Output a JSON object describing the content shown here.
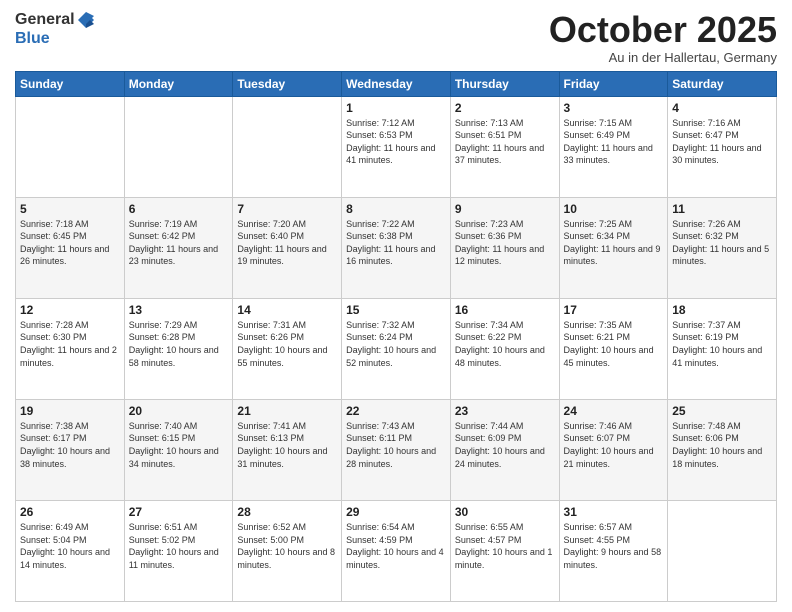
{
  "header": {
    "logo_general": "General",
    "logo_blue": "Blue",
    "month_title": "October 2025",
    "subtitle": "Au in der Hallertau, Germany"
  },
  "weekdays": [
    "Sunday",
    "Monday",
    "Tuesday",
    "Wednesday",
    "Thursday",
    "Friday",
    "Saturday"
  ],
  "days": {
    "d1": {
      "num": "1",
      "sunrise": "Sunrise: 7:12 AM",
      "sunset": "Sunset: 6:53 PM",
      "daylight": "Daylight: 11 hours and 41 minutes."
    },
    "d2": {
      "num": "2",
      "sunrise": "Sunrise: 7:13 AM",
      "sunset": "Sunset: 6:51 PM",
      "daylight": "Daylight: 11 hours and 37 minutes."
    },
    "d3": {
      "num": "3",
      "sunrise": "Sunrise: 7:15 AM",
      "sunset": "Sunset: 6:49 PM",
      "daylight": "Daylight: 11 hours and 33 minutes."
    },
    "d4": {
      "num": "4",
      "sunrise": "Sunrise: 7:16 AM",
      "sunset": "Sunset: 6:47 PM",
      "daylight": "Daylight: 11 hours and 30 minutes."
    },
    "d5": {
      "num": "5",
      "sunrise": "Sunrise: 7:18 AM",
      "sunset": "Sunset: 6:45 PM",
      "daylight": "Daylight: 11 hours and 26 minutes."
    },
    "d6": {
      "num": "6",
      "sunrise": "Sunrise: 7:19 AM",
      "sunset": "Sunset: 6:42 PM",
      "daylight": "Daylight: 11 hours and 23 minutes."
    },
    "d7": {
      "num": "7",
      "sunrise": "Sunrise: 7:20 AM",
      "sunset": "Sunset: 6:40 PM",
      "daylight": "Daylight: 11 hours and 19 minutes."
    },
    "d8": {
      "num": "8",
      "sunrise": "Sunrise: 7:22 AM",
      "sunset": "Sunset: 6:38 PM",
      "daylight": "Daylight: 11 hours and 16 minutes."
    },
    "d9": {
      "num": "9",
      "sunrise": "Sunrise: 7:23 AM",
      "sunset": "Sunset: 6:36 PM",
      "daylight": "Daylight: 11 hours and 12 minutes."
    },
    "d10": {
      "num": "10",
      "sunrise": "Sunrise: 7:25 AM",
      "sunset": "Sunset: 6:34 PM",
      "daylight": "Daylight: 11 hours and 9 minutes."
    },
    "d11": {
      "num": "11",
      "sunrise": "Sunrise: 7:26 AM",
      "sunset": "Sunset: 6:32 PM",
      "daylight": "Daylight: 11 hours and 5 minutes."
    },
    "d12": {
      "num": "12",
      "sunrise": "Sunrise: 7:28 AM",
      "sunset": "Sunset: 6:30 PM",
      "daylight": "Daylight: 11 hours and 2 minutes."
    },
    "d13": {
      "num": "13",
      "sunrise": "Sunrise: 7:29 AM",
      "sunset": "Sunset: 6:28 PM",
      "daylight": "Daylight: 10 hours and 58 minutes."
    },
    "d14": {
      "num": "14",
      "sunrise": "Sunrise: 7:31 AM",
      "sunset": "Sunset: 6:26 PM",
      "daylight": "Daylight: 10 hours and 55 minutes."
    },
    "d15": {
      "num": "15",
      "sunrise": "Sunrise: 7:32 AM",
      "sunset": "Sunset: 6:24 PM",
      "daylight": "Daylight: 10 hours and 52 minutes."
    },
    "d16": {
      "num": "16",
      "sunrise": "Sunrise: 7:34 AM",
      "sunset": "Sunset: 6:22 PM",
      "daylight": "Daylight: 10 hours and 48 minutes."
    },
    "d17": {
      "num": "17",
      "sunrise": "Sunrise: 7:35 AM",
      "sunset": "Sunset: 6:21 PM",
      "daylight": "Daylight: 10 hours and 45 minutes."
    },
    "d18": {
      "num": "18",
      "sunrise": "Sunrise: 7:37 AM",
      "sunset": "Sunset: 6:19 PM",
      "daylight": "Daylight: 10 hours and 41 minutes."
    },
    "d19": {
      "num": "19",
      "sunrise": "Sunrise: 7:38 AM",
      "sunset": "Sunset: 6:17 PM",
      "daylight": "Daylight: 10 hours and 38 minutes."
    },
    "d20": {
      "num": "20",
      "sunrise": "Sunrise: 7:40 AM",
      "sunset": "Sunset: 6:15 PM",
      "daylight": "Daylight: 10 hours and 34 minutes."
    },
    "d21": {
      "num": "21",
      "sunrise": "Sunrise: 7:41 AM",
      "sunset": "Sunset: 6:13 PM",
      "daylight": "Daylight: 10 hours and 31 minutes."
    },
    "d22": {
      "num": "22",
      "sunrise": "Sunrise: 7:43 AM",
      "sunset": "Sunset: 6:11 PM",
      "daylight": "Daylight: 10 hours and 28 minutes."
    },
    "d23": {
      "num": "23",
      "sunrise": "Sunrise: 7:44 AM",
      "sunset": "Sunset: 6:09 PM",
      "daylight": "Daylight: 10 hours and 24 minutes."
    },
    "d24": {
      "num": "24",
      "sunrise": "Sunrise: 7:46 AM",
      "sunset": "Sunset: 6:07 PM",
      "daylight": "Daylight: 10 hours and 21 minutes."
    },
    "d25": {
      "num": "25",
      "sunrise": "Sunrise: 7:48 AM",
      "sunset": "Sunset: 6:06 PM",
      "daylight": "Daylight: 10 hours and 18 minutes."
    },
    "d26": {
      "num": "26",
      "sunrise": "Sunrise: 6:49 AM",
      "sunset": "Sunset: 5:04 PM",
      "daylight": "Daylight: 10 hours and 14 minutes."
    },
    "d27": {
      "num": "27",
      "sunrise": "Sunrise: 6:51 AM",
      "sunset": "Sunset: 5:02 PM",
      "daylight": "Daylight: 10 hours and 11 minutes."
    },
    "d28": {
      "num": "28",
      "sunrise": "Sunrise: 6:52 AM",
      "sunset": "Sunset: 5:00 PM",
      "daylight": "Daylight: 10 hours and 8 minutes."
    },
    "d29": {
      "num": "29",
      "sunrise": "Sunrise: 6:54 AM",
      "sunset": "Sunset: 4:59 PM",
      "daylight": "Daylight: 10 hours and 4 minutes."
    },
    "d30": {
      "num": "30",
      "sunrise": "Sunrise: 6:55 AM",
      "sunset": "Sunset: 4:57 PM",
      "daylight": "Daylight: 10 hours and 1 minute."
    },
    "d31": {
      "num": "31",
      "sunrise": "Sunrise: 6:57 AM",
      "sunset": "Sunset: 4:55 PM",
      "daylight": "Daylight: 9 hours and 58 minutes."
    }
  }
}
